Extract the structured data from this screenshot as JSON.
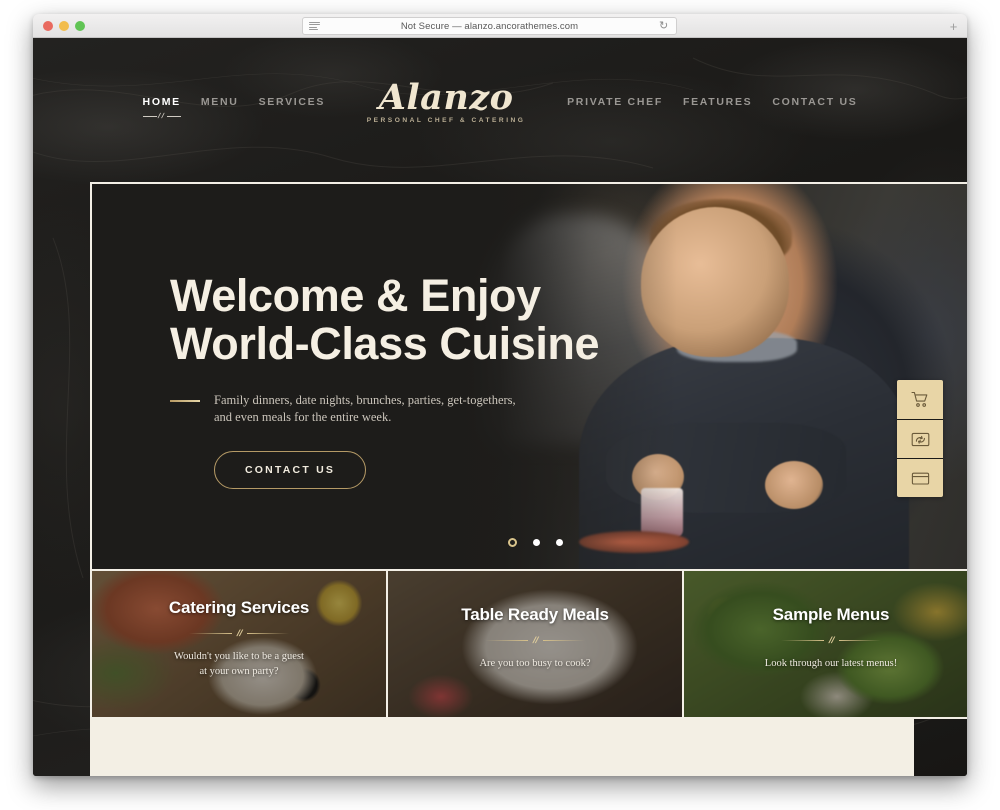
{
  "browser": {
    "url_text": "Not Secure — alanzo.ancorathemes.com",
    "reader_icon": "reader-view-icon",
    "reload_icon": "reload-icon",
    "new_tab_icon": "plus-icon",
    "traffic_lights": [
      "close",
      "minimize",
      "zoom"
    ]
  },
  "header": {
    "logo": {
      "name": "Alanzo",
      "tagline": "PERSONAL CHEF & CATERING"
    },
    "nav_left": [
      {
        "label": "HOME",
        "active": true
      },
      {
        "label": "MENU",
        "active": false
      },
      {
        "label": "SERVICES",
        "active": false
      }
    ],
    "nav_right": [
      {
        "label": "PRIVATE CHEF",
        "active": false
      },
      {
        "label": "FEATURES",
        "active": false
      },
      {
        "label": "CONTACT US",
        "active": false
      }
    ]
  },
  "hero": {
    "title_line1": "Welcome & Enjoy",
    "title_line2": "World-Class Cuisine",
    "subtitle_line1": "Family dinners, date nights, brunches, parties, get-togethers,",
    "subtitle_line2": "and even meals for the entire week.",
    "button_label": "CONTACT US",
    "slides": [
      {
        "index": 1,
        "active": true
      },
      {
        "index": 2,
        "active": false
      },
      {
        "index": 3,
        "active": false
      }
    ]
  },
  "cards": [
    {
      "title": "Catering Services",
      "subtitle_line1": "Wouldn't you like to be a guest",
      "subtitle_line2": "at your own party?"
    },
    {
      "title": "Table Ready Meals",
      "subtitle_line1": "Are you too busy to cook?",
      "subtitle_line2": ""
    },
    {
      "title": "Sample Menus",
      "subtitle_line1": "Look through our latest menus!",
      "subtitle_line2": ""
    }
  ],
  "side_buttons": [
    {
      "icon": "shopping-cart-icon"
    },
    {
      "icon": "image-swap-icon"
    },
    {
      "icon": "card-window-icon"
    }
  ],
  "colors": {
    "gold": "#d6c08a",
    "cream": "#f3efe4",
    "dark": "#1a1917",
    "side_button_bg": "#e8d5a6"
  }
}
